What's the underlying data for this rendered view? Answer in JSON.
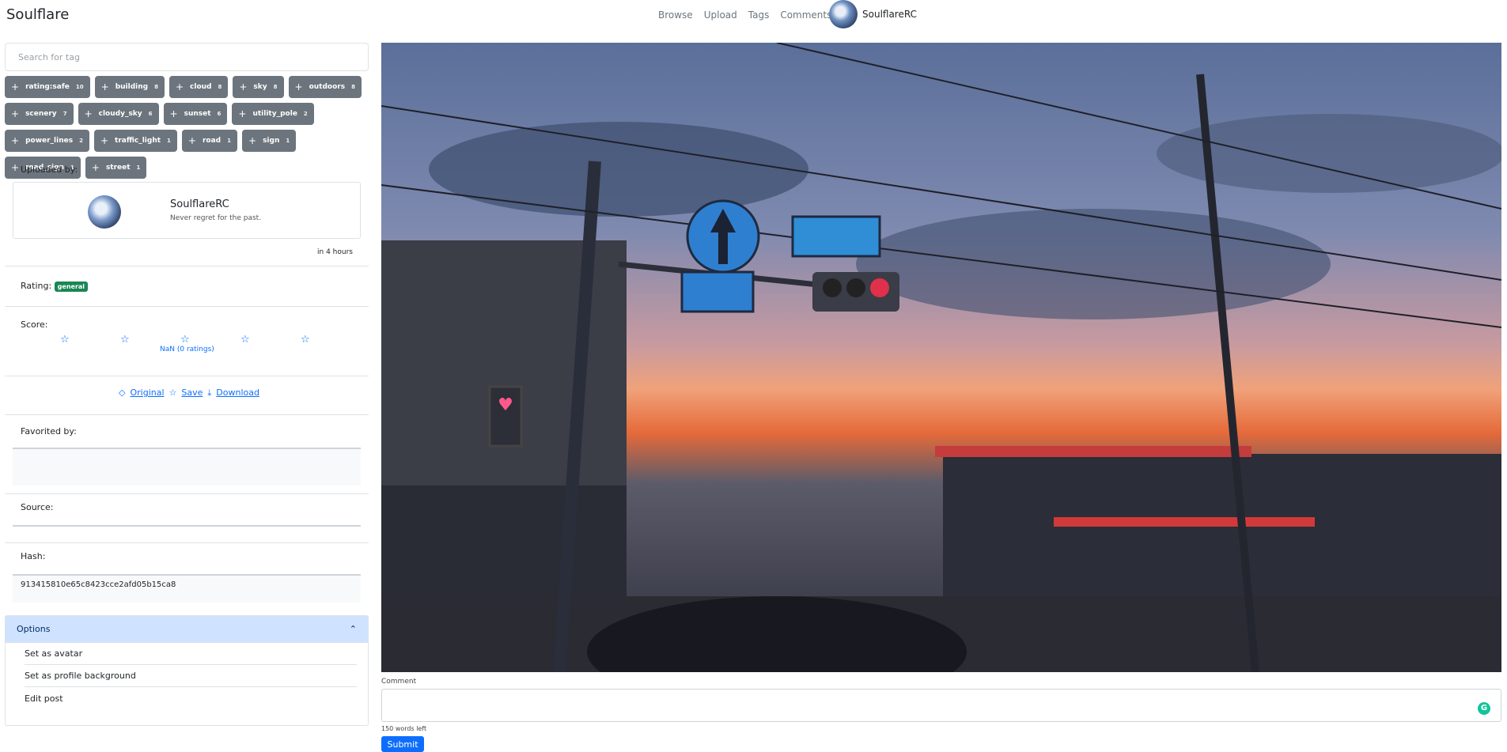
{
  "header": {
    "brand": "Soulflare",
    "nav": [
      "Browse",
      "Upload",
      "Tags",
      "Comments"
    ],
    "user_name": "SoulflareRC"
  },
  "sidebar": {
    "search_placeholder": "Search for tag",
    "tags": [
      {
        "name": "rating:safe",
        "count": "10"
      },
      {
        "name": "building",
        "count": "8"
      },
      {
        "name": "cloud",
        "count": "8"
      },
      {
        "name": "sky",
        "count": "8"
      },
      {
        "name": "outdoors",
        "count": "8"
      },
      {
        "name": "scenery",
        "count": "7"
      },
      {
        "name": "cloudy_sky",
        "count": "6"
      },
      {
        "name": "sunset",
        "count": "6"
      },
      {
        "name": "utility_pole",
        "count": "2"
      },
      {
        "name": "power_lines",
        "count": "2"
      },
      {
        "name": "traffic_light",
        "count": "1"
      },
      {
        "name": "road",
        "count": "1"
      },
      {
        "name": "sign",
        "count": "1"
      },
      {
        "name": "road_sign",
        "count": "1"
      },
      {
        "name": "street",
        "count": "1"
      }
    ],
    "uploaded_by_label": "Uploaded by:",
    "uploader_name": "SoulflareRC",
    "uploader_bio": "Never regret for the past.",
    "upload_time": "in 4 hours",
    "rating_label": "Rating:",
    "rating_value": "general",
    "score_label": "Score:",
    "score_text": "NaN (0 ratings)",
    "links": {
      "original": "Original",
      "save": "Save",
      "download": "Download"
    },
    "favorited_label": "Favorited by:",
    "source_label": "Source:",
    "hash_label": "Hash:",
    "hash_value": "913415810e65c8423cce2afd05b15ca8",
    "options_label": "Options",
    "options": [
      "Set as avatar",
      "Set as profile background",
      "Edit post"
    ]
  },
  "main": {
    "comment_label": "Comment",
    "words_left": "150 words left",
    "submit_label": "Submit"
  }
}
